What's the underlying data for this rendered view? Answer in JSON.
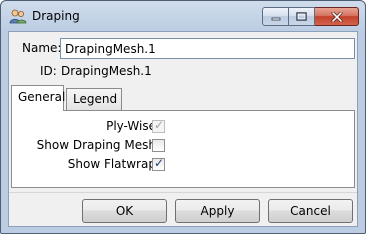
{
  "window": {
    "title": "Draping"
  },
  "form": {
    "name_label": "Name:",
    "name_value": "DrapingMesh.1",
    "id_label": "ID:",
    "id_value": "DrapingMesh.1"
  },
  "tabs": [
    {
      "label": "General",
      "active": true
    },
    {
      "label": "Legend",
      "active": false
    }
  ],
  "general": {
    "ply_wise_label": "Ply-Wise:",
    "ply_wise_checked": true,
    "ply_wise_disabled": true,
    "show_draping_mesh_label": "Show Draping Mesh:",
    "show_draping_mesh_checked": false,
    "show_flatwrap_label": "Show Flatwrap:",
    "show_flatwrap_checked": true
  },
  "buttons": {
    "ok": "OK",
    "apply": "Apply",
    "cancel": "Cancel"
  },
  "icons": {
    "app": "people-icon",
    "minimize": "minimize-icon",
    "maximize": "maximize-icon",
    "close": "close-icon"
  }
}
